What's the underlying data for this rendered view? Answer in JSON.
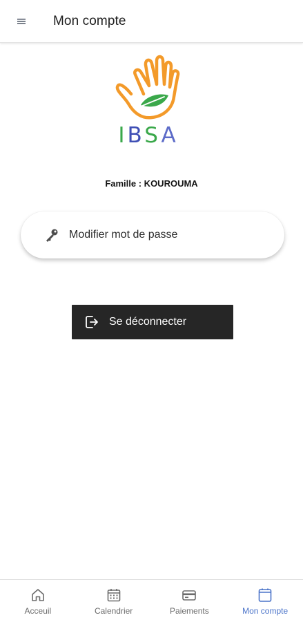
{
  "app_bar": {
    "title": "Mon compte",
    "menu_icon": "menu-icon"
  },
  "logo": {
    "letters": [
      "I",
      "B",
      "S",
      "A"
    ],
    "colors": {
      "hand": "#f39a2a",
      "leaf": "#3aa84a"
    }
  },
  "family": {
    "label": "Famille : KOUROUMA"
  },
  "password_card": {
    "label": "Modifier mot de passe",
    "icon": "key-icon"
  },
  "logout": {
    "label": "Se déconnecter",
    "icon": "logout-icon",
    "background": "#262626"
  },
  "bottom_nav": {
    "items": [
      {
        "label": "Acceuil",
        "icon": "home-icon",
        "active": false
      },
      {
        "label": "Calendrier",
        "icon": "calendar-icon",
        "active": false
      },
      {
        "label": "Paiements",
        "icon": "card-icon",
        "active": false
      },
      {
        "label": "Mon compte",
        "icon": "account-icon",
        "active": true
      }
    ],
    "active_color": "#4a73c9"
  }
}
